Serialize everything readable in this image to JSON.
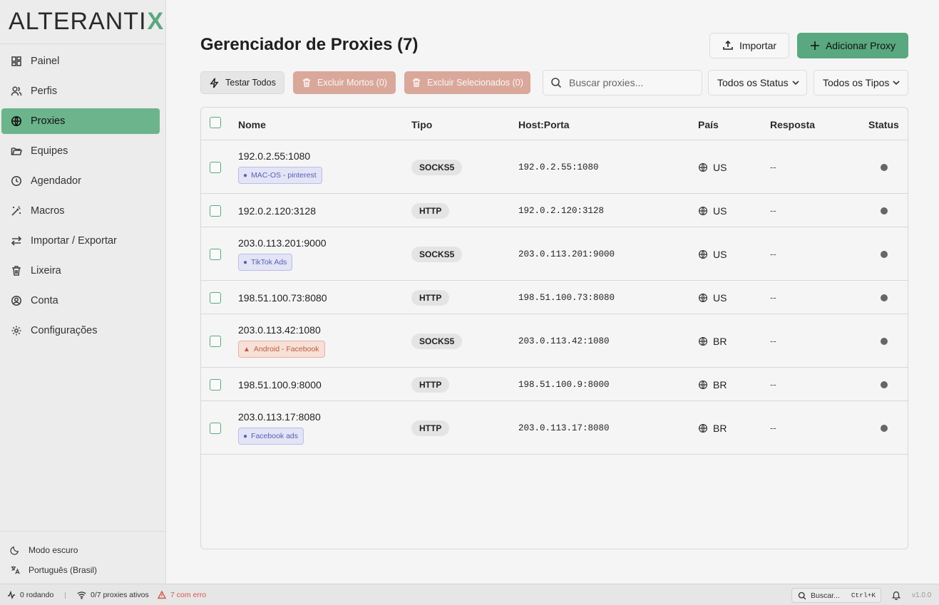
{
  "app": {
    "logo_text": "ALTERANTI",
    "logo_x": "X"
  },
  "sidebar": {
    "items": [
      {
        "label": "Painel",
        "icon": "dashboard-icon"
      },
      {
        "label": "Perfis",
        "icon": "users-icon"
      },
      {
        "label": "Proxies",
        "icon": "globe-icon",
        "active": true
      },
      {
        "label": "Equipes",
        "icon": "folder-icon"
      },
      {
        "label": "Agendador",
        "icon": "clock-icon"
      },
      {
        "label": "Macros",
        "icon": "magic-wand-icon"
      },
      {
        "label": "Importar / Exportar",
        "icon": "arrows-swap-icon"
      },
      {
        "label": "Lixeira",
        "icon": "trash-icon"
      },
      {
        "label": "Conta",
        "icon": "user-circle-icon"
      },
      {
        "label": "Configurações",
        "icon": "gear-icon"
      }
    ],
    "dark_mode_label": "Modo escuro",
    "language_label": "Português (Brasil)"
  },
  "header": {
    "title": "Gerenciador de Proxies (7)",
    "import_label": "Importar",
    "add_label": "Adicionar Proxy"
  },
  "toolbar": {
    "test_all_label": "Testar Todos",
    "delete_dead_label": "Excluir Mortos (0)",
    "delete_selected_label": "Excluir Selecionados (0)",
    "search_placeholder": "Buscar proxies...",
    "status_filter": "Todos os Status",
    "type_filter": "Todos os Tipos"
  },
  "table": {
    "columns": [
      "Nome",
      "Tipo",
      "Host:Porta",
      "País",
      "Resposta",
      "Status"
    ],
    "rows": [
      {
        "name": "192.0.2.55:1080",
        "tag": "MAC-OS - pinterest",
        "tag_style": "blue",
        "tag_icon": "apple-icon",
        "type": "SOCKS5",
        "host": "192.0.2.55:1080",
        "country": "US",
        "response": "--"
      },
      {
        "name": "192.0.2.120:3128",
        "tag": "",
        "type": "HTTP",
        "host": "192.0.2.120:3128",
        "country": "US",
        "response": "--"
      },
      {
        "name": "203.0.113.201:9000",
        "tag": "TikTok Ads",
        "tag_style": "blue",
        "tag_icon": "apple-icon",
        "type": "SOCKS5",
        "host": "203.0.113.201:9000",
        "country": "US",
        "response": "--"
      },
      {
        "name": "198.51.100.73:8080",
        "tag": "",
        "type": "HTTP",
        "host": "198.51.100.73:8080",
        "country": "US",
        "response": "--"
      },
      {
        "name": "203.0.113.42:1080",
        "tag": "Android - Facebook",
        "tag_style": "orange",
        "tag_icon": "linux-icon",
        "type": "SOCKS5",
        "host": "203.0.113.42:1080",
        "country": "BR",
        "response": "--"
      },
      {
        "name": "198.51.100.9:8000",
        "tag": "",
        "type": "HTTP",
        "host": "198.51.100.9:8000",
        "country": "BR",
        "response": "--"
      },
      {
        "name": "203.0.113.17:8080",
        "tag": "Facebook ads",
        "tag_style": "blue",
        "tag_icon": "apple-icon",
        "type": "HTTP",
        "host": "203.0.113.17:8080",
        "country": "BR",
        "response": "--"
      }
    ]
  },
  "statusbar": {
    "running": "0 rodando",
    "active_proxies": "0/7 proxies ativos",
    "errors": "7 com erro",
    "search_label": "Buscar...",
    "shortcut": "Ctrl+K",
    "version": "v1.0.0"
  },
  "colors": {
    "accent": "#5aa87f",
    "danger_button": "#d9a89b",
    "error_text": "#d45a4a"
  }
}
